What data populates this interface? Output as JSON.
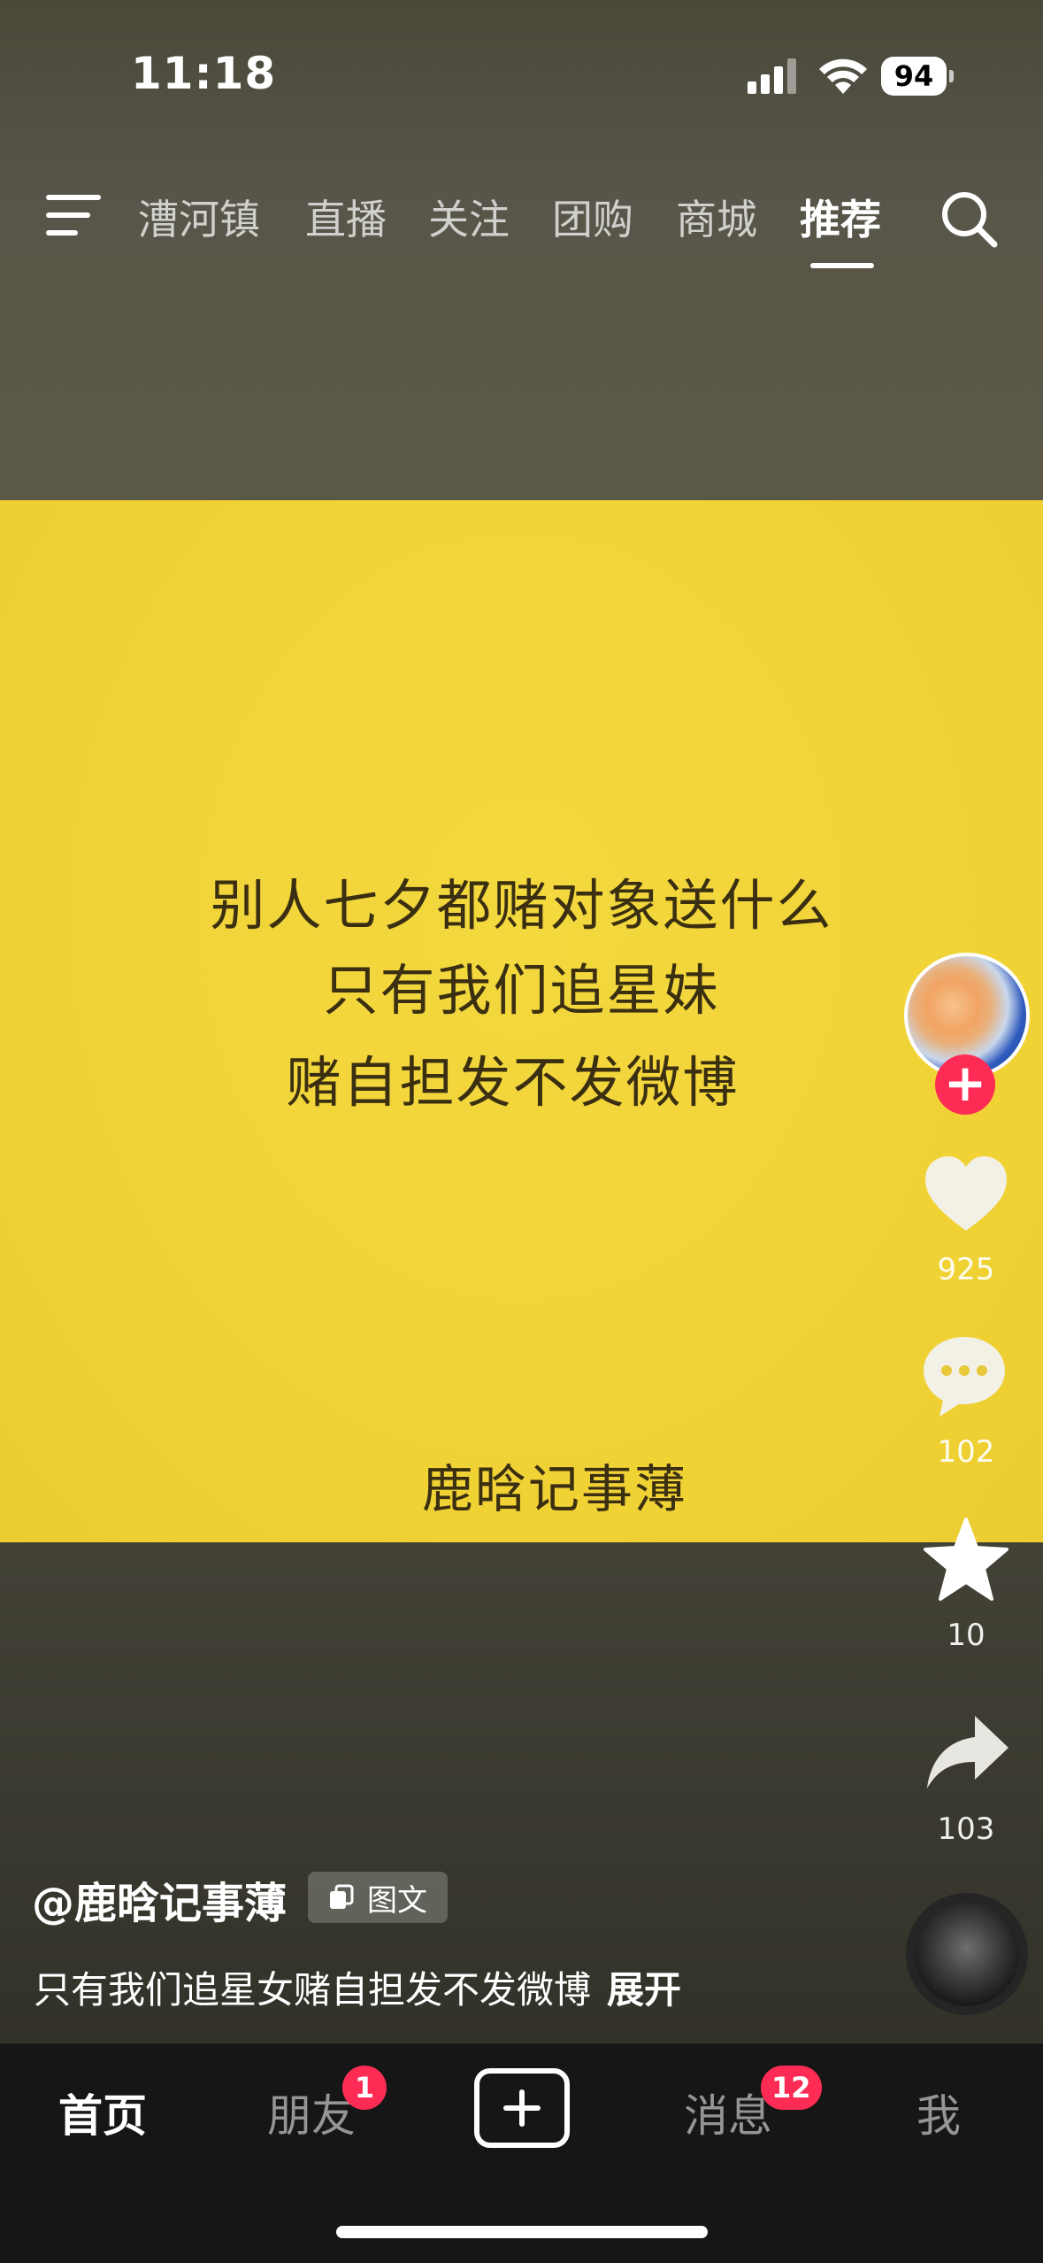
{
  "status_bar": {
    "time": "11:18",
    "battery": "94"
  },
  "top_nav": {
    "tabs": [
      {
        "label": "漕河镇"
      },
      {
        "label": "直播"
      },
      {
        "label": "关注"
      },
      {
        "label": "团购"
      },
      {
        "label": "商城"
      },
      {
        "label": "推荐",
        "active": true
      }
    ]
  },
  "post_image": {
    "lines": [
      "别人七夕都赌对象送什么",
      "只有我们追星妹",
      "赌自担发不发微博"
    ],
    "signature": "鹿晗记事薄",
    "background_color": "#f1d53a"
  },
  "actions": {
    "likes": "925",
    "comments": "102",
    "favorites": "10",
    "shares": "103"
  },
  "caption": {
    "author": "@鹿晗记事薄",
    "tag": "图文",
    "description": "只有我们追星女赌自担发不发微博",
    "expand": "展开"
  },
  "bottom_tabs": {
    "home": "首页",
    "friends": "朋友",
    "friends_badge": "1",
    "messages": "消息",
    "messages_badge": "12",
    "me": "我"
  },
  "colors": {
    "accent": "#fe2c55"
  }
}
